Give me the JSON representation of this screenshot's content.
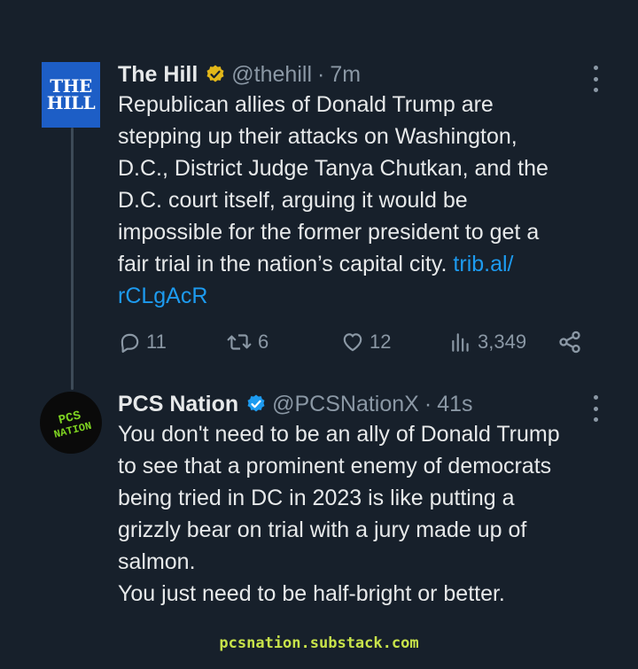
{
  "tweets": [
    {
      "author_name": "The Hill",
      "handle": "@thehill",
      "separator": "·",
      "time": "7m",
      "avatar_text": [
        "THE",
        "HILL"
      ],
      "text_lines": [
        "Republican allies of Donald Trump are",
        "stepping up their attacks on Washington,",
        "D.C., District Judge Tanya Chutkan, and the",
        "D.C. court itself, arguing it would be",
        "impossible for the former president to get a",
        "fair trial in the nation’s capital city. "
      ],
      "link_part1": "trib.al/",
      "link_part2": "rCLgAcR",
      "replies": "11",
      "retweets": "6",
      "likes": "12",
      "views": "3,349"
    },
    {
      "author_name": "PCS Nation",
      "handle": "@PCSNationX",
      "separator": "·",
      "time": "41s",
      "avatar_text": [
        "PCS",
        "NATION"
      ],
      "text_lines": [
        "You don't need to be an ally of Donald Trump",
        "to see that a prominent enemy of democrats",
        "being tried in DC in 2023 is like putting a",
        "grizzly bear on trial with a jury made up of",
        "salmon.",
        "You just need to be half-bright or better."
      ]
    }
  ],
  "colors": {
    "background": "#17202b",
    "verified_gold": "#e2b719",
    "verified_blue": "#1d9bf0",
    "link": "#1d9bf0",
    "watermark": "#c8e34a",
    "avatar_hill": "#1d5ec6",
    "avatar_pcs_text": "#7ed321"
  },
  "icons": [
    "gold-verified-badge-icon",
    "blue-verified-badge-icon",
    "more-options-icon",
    "reply-icon",
    "retweet-icon",
    "like-icon",
    "views-icon",
    "share-icon"
  ],
  "watermark": "pcsnation.substack.com"
}
